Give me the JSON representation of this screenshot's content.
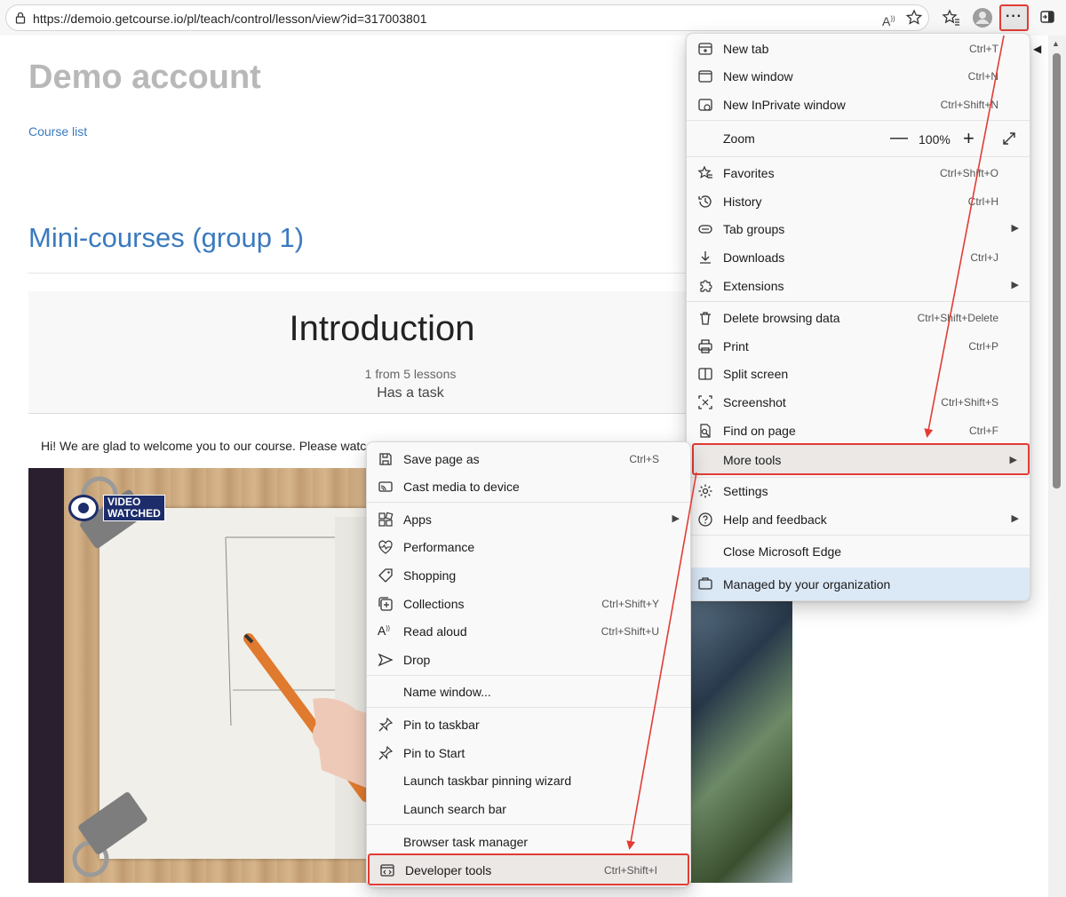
{
  "browser": {
    "url": "https://demoio.getcourse.io/pl/teach/control/lesson/view?id=317003801",
    "read_aloud_icon": "read-aloud-icon",
    "menu_button_label": "···"
  },
  "page": {
    "site_title": "Demo account",
    "course_list_link": "Course list",
    "group_title": "Mini-courses (group 1)",
    "lesson_title": "Introduction",
    "lessons_count": "1 from 5 lessons",
    "has_task": "Has a task",
    "welcome_text": "Hi! We are glad to welcome you to our course. Please watc",
    "video_badge": [
      "VIDEO",
      "WATCHED"
    ]
  },
  "main_menu": {
    "items": [
      {
        "label": "New tab",
        "shortcut": "Ctrl+T",
        "icon": "new-tab-icon"
      },
      {
        "label": "New window",
        "shortcut": "Ctrl+N",
        "icon": "new-window-icon"
      },
      {
        "label": "New InPrivate window",
        "shortcut": "Ctrl+Shift+N",
        "icon": "inprivate-icon"
      },
      {
        "label": "Zoom",
        "value": "100%",
        "minus": "—",
        "plus": "+"
      },
      {
        "label": "Favorites",
        "shortcut": "Ctrl+Shift+O",
        "icon": "favorites-icon"
      },
      {
        "label": "History",
        "shortcut": "Ctrl+H",
        "icon": "history-icon"
      },
      {
        "label": "Tab groups",
        "shortcut": "",
        "icon": "tab-groups-icon",
        "submenu": true
      },
      {
        "label": "Downloads",
        "shortcut": "Ctrl+J",
        "icon": "downloads-icon"
      },
      {
        "label": "Extensions",
        "shortcut": "",
        "icon": "extensions-icon",
        "submenu": true
      },
      {
        "label": "Delete browsing data",
        "shortcut": "Ctrl+Shift+Delete",
        "icon": "trash-icon"
      },
      {
        "label": "Print",
        "shortcut": "Ctrl+P",
        "icon": "print-icon"
      },
      {
        "label": "Split screen",
        "shortcut": "",
        "icon": "split-screen-icon"
      },
      {
        "label": "Screenshot",
        "shortcut": "Ctrl+Shift+S",
        "icon": "screenshot-icon"
      },
      {
        "label": "Find on page",
        "shortcut": "Ctrl+F",
        "icon": "find-icon"
      },
      {
        "label": "More tools",
        "shortcut": "",
        "icon": "",
        "submenu": true,
        "highlighted": true
      },
      {
        "label": "Settings",
        "shortcut": "",
        "icon": "settings-icon"
      },
      {
        "label": "Help and feedback",
        "shortcut": "",
        "icon": "help-icon",
        "submenu": true
      },
      {
        "label": "Close Microsoft Edge",
        "shortcut": "",
        "icon": ""
      },
      {
        "label": "Managed by your organization",
        "shortcut": "",
        "icon": "briefcase-icon"
      }
    ]
  },
  "more_tools_menu": {
    "items": [
      {
        "label": "Save page as",
        "shortcut": "Ctrl+S",
        "icon": "save-icon"
      },
      {
        "label": "Cast media to device",
        "shortcut": "",
        "icon": "cast-icon"
      },
      {
        "label": "Apps",
        "shortcut": "",
        "icon": "apps-icon",
        "submenu": true
      },
      {
        "label": "Performance",
        "shortcut": "",
        "icon": "performance-icon"
      },
      {
        "label": "Shopping",
        "shortcut": "",
        "icon": "shopping-tag-icon"
      },
      {
        "label": "Collections",
        "shortcut": "Ctrl+Shift+Y",
        "icon": "collections-icon"
      },
      {
        "label": "Read aloud",
        "shortcut": "Ctrl+Shift+U",
        "icon": "read-aloud-icon"
      },
      {
        "label": "Drop",
        "shortcut": "",
        "icon": "drop-icon"
      },
      {
        "label": "Name window...",
        "shortcut": "",
        "icon": ""
      },
      {
        "label": "Pin to taskbar",
        "shortcut": "",
        "icon": "pin-icon"
      },
      {
        "label": "Pin to Start",
        "shortcut": "",
        "icon": "pin-icon"
      },
      {
        "label": "Launch taskbar pinning wizard",
        "shortcut": "",
        "icon": ""
      },
      {
        "label": "Launch search bar",
        "shortcut": "",
        "icon": ""
      },
      {
        "label": "Browser task manager",
        "shortcut": "",
        "icon": ""
      },
      {
        "label": "Developer tools",
        "shortcut": "Ctrl+Shift+I",
        "icon": "developer-tools-icon",
        "highlighted": true
      }
    ]
  },
  "colors": {
    "highlight_border": "#e23c35",
    "link_blue": "#3a7abf",
    "managed_bg": "#dbe8f6"
  }
}
